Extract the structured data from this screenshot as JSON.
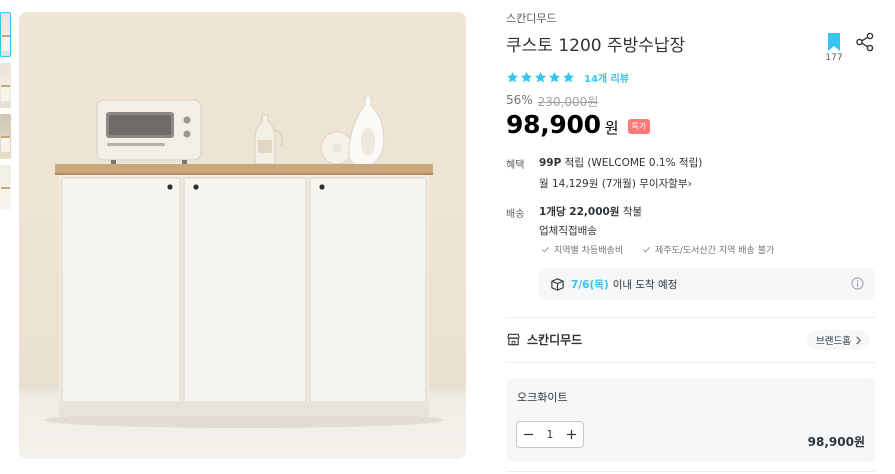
{
  "thumbnails": [
    {
      "alt": "product-thumbnail-1",
      "active": true
    },
    {
      "alt": "product-thumbnail-2",
      "active": false
    },
    {
      "alt": "product-thumbnail-3",
      "active": false
    },
    {
      "alt": "product-thumbnail-4",
      "active": false
    }
  ],
  "product": {
    "brand": "스칸디무드",
    "title": "쿠스토 1200 주방수납장",
    "bookmark_count": "177",
    "rating_stars": 5,
    "review_count": "14개 리뷰",
    "discount": "56%",
    "original_price": "230,000원",
    "price": "98,900",
    "price_unit": "원",
    "badge": "특가"
  },
  "benefits": {
    "label": "혜택",
    "points": "99P",
    "points_text": "적립 (WELCOME 0.1% 적립)",
    "installment": "월 14,129원 (7개월) 무이자할부",
    "installment_chevron": "›"
  },
  "shipping": {
    "label": "배송",
    "fee_strong": "1개당 22,000원",
    "fee_suffix": "착불",
    "method": "업체직접배송",
    "notes": [
      "지역별 차등배송비",
      "제주도/도서산간 지역 배송 불가"
    ],
    "arrival_date": "7/6(목)",
    "arrival_text": "이내 도착 예정"
  },
  "brand_section": {
    "name": "스칸디무드",
    "home_button": "브랜드홈"
  },
  "option": {
    "name": "오크화이트",
    "quantity": "1",
    "price": "98,900원"
  },
  "colors": {
    "accent": "#35c5f0",
    "badge": "#ff7777",
    "text": "#2f3438",
    "muted": "#757575"
  }
}
